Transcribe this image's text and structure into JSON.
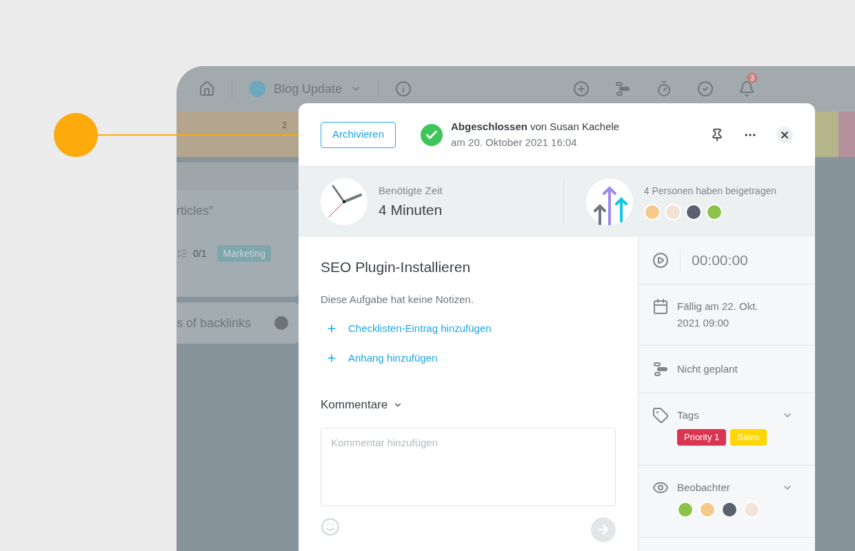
{
  "topbar": {
    "project": "Blog Update",
    "notification_count": "3"
  },
  "board": {
    "column_count": "2",
    "cards": [
      {
        "title": "rticles\"",
        "checklist": "0/1",
        "tag": "Marketing"
      },
      {
        "title": "s of backlinks"
      }
    ]
  },
  "task": {
    "archive_button": "Archivieren",
    "status": {
      "label": "Abgeschlossen",
      "by": "von Susan Kachele",
      "date": "am 20. Oktober 2021 16:04"
    },
    "time": {
      "label": "Benötigte Zeit",
      "value": "4 Minuten"
    },
    "contributors": {
      "label": "4 Personen haben beigetragen",
      "avatars": [
        {
          "color": "#f4c98a"
        },
        {
          "color": "#f3e2d6"
        },
        {
          "color": "#5a6170"
        },
        {
          "color": "#8bc34a"
        }
      ]
    },
    "title": "SEO Plugin-Installieren",
    "notes": "Diese Aufgabe hat keine Notizen.",
    "actions": [
      "Checklisten-Eintrag hinzufügen",
      "Anhang hinzufügen"
    ],
    "comments": {
      "heading": "Kommentare",
      "placeholder": "Kommentar hinzufügen"
    }
  },
  "sidebar": {
    "timer": "00:00:00",
    "due": "Fällig am 22. Okt. 2021 09:00",
    "schedule": "Nicht geplant",
    "tags": {
      "label": "Tags",
      "items": [
        {
          "label": "Priority 1",
          "color": "#d93450"
        },
        {
          "label": "Sales",
          "color": "#ffd600"
        }
      ]
    },
    "watchers": {
      "label": "Beobachter",
      "avatars": [
        {
          "color": "#8bc34a"
        },
        {
          "color": "#f4c98a"
        },
        {
          "color": "#5a6170"
        },
        {
          "color": "#f3e2d6"
        }
      ]
    }
  }
}
